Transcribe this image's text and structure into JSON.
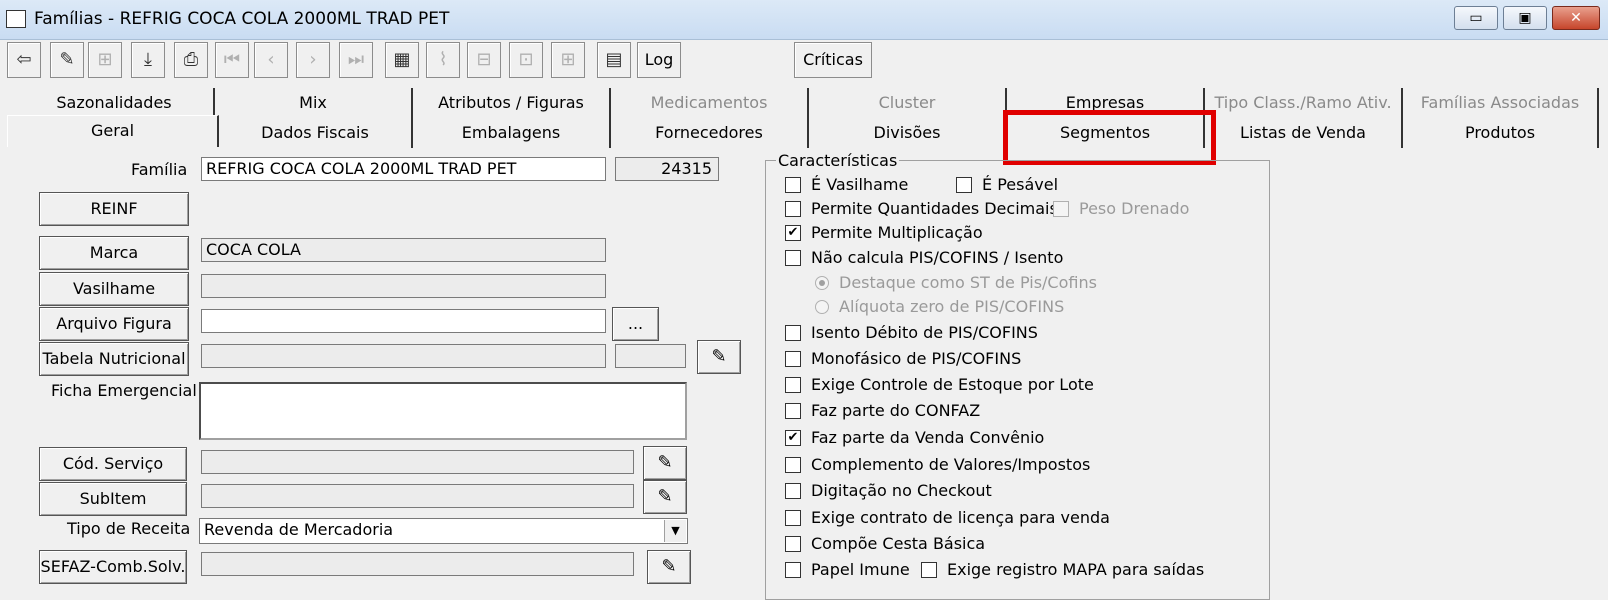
{
  "window": {
    "title": "Famílias - REFRIG COCA COLA 2000ML TRAD PET",
    "min": "▭",
    "max": "▣",
    "close": "✕"
  },
  "toolbar": {
    "log_label": "Log",
    "criticas_label": "Críticas",
    "icons": [
      "exit-icon",
      "eraser-icon",
      "tree-icon",
      "download-icon",
      "print-icon",
      "first-icon",
      "prev-icon",
      "next-icon",
      "last-icon",
      "grid-icon",
      "chart-icon",
      "layout1-icon",
      "layout2-icon",
      "layout3-icon",
      "calendar-icon"
    ]
  },
  "tabs_row1": [
    {
      "label": "Sazonalidades",
      "disabled": false
    },
    {
      "label": "Mix",
      "disabled": false
    },
    {
      "label": "Atributos / Figuras",
      "disabled": false
    },
    {
      "label": "Medicamentos",
      "disabled": true
    },
    {
      "label": "Cluster",
      "disabled": true
    },
    {
      "label": "Empresas",
      "disabled": false
    },
    {
      "label": "Tipo Class./Ramo Ativ.",
      "disabled": true
    },
    {
      "label": "Famílias Associadas",
      "disabled": true
    }
  ],
  "tabs_row2": [
    {
      "label": "Geral",
      "active": true
    },
    {
      "label": "Dados Fiscais"
    },
    {
      "label": "Embalagens"
    },
    {
      "label": "Fornecedores"
    },
    {
      "label": "Divisões"
    },
    {
      "label": "Segmentos",
      "highlighted": true
    },
    {
      "label": "Listas de Venda"
    },
    {
      "label": "Produtos"
    }
  ],
  "form": {
    "familia_label": "Família",
    "familia_value": "REFRIG COCA COLA 2000ML TRAD PET",
    "familia_code": "24315",
    "reinf_button": "REINF",
    "marca_button": "Marca",
    "marca_value": "COCA COLA",
    "vasilhame_button": "Vasilhame",
    "arquivo_button": "Arquivo Figura",
    "browse_button": "...",
    "tabela_button": "Tabela Nutricional",
    "ficha_label": "Ficha Emergencial",
    "cod_servico_button": "Cód. Serviço",
    "subitem_button": "SubItem",
    "tipo_receita_label": "Tipo de Receita",
    "tipo_receita_value": "Revenda de Mercadoria",
    "sefaz_button": "SEFAZ-Comb.Solv."
  },
  "caracteristicas": {
    "title": "Características",
    "items": [
      {
        "label": "É Vasilhame",
        "checked": false
      },
      {
        "label": "É Pesável",
        "checked": false
      },
      {
        "label": "Permite Quantidades Decimais",
        "checked": false
      },
      {
        "label": "Peso Drenado",
        "checked": false,
        "disabled": true
      },
      {
        "label": "Permite Multiplicação",
        "checked": true
      },
      {
        "label": "Não calcula PIS/COFINS / Isento",
        "checked": false
      },
      {
        "label": "Destaque como ST de Pis/Cofins",
        "radio": true,
        "selected": true,
        "disabled": true
      },
      {
        "label": "Alíquota zero de PIS/COFINS",
        "radio": true,
        "selected": false,
        "disabled": true
      },
      {
        "label": "Isento Débito de PIS/COFINS",
        "checked": false
      },
      {
        "label": "Monofásico de PIS/COFINS",
        "checked": false
      },
      {
        "label": "Exige Controle de Estoque por Lote",
        "checked": false
      },
      {
        "label": "Faz parte do CONFAZ",
        "checked": false
      },
      {
        "label": "Faz parte da Venda Convênio",
        "checked": true
      },
      {
        "label": "Complemento de Valores/Impostos",
        "checked": false
      },
      {
        "label": "Digitação no Checkout",
        "checked": false
      },
      {
        "label": "Exige contrato de licença para venda",
        "checked": false
      },
      {
        "label": "Compõe Cesta Básica",
        "checked": false
      },
      {
        "label": "Papel Imune",
        "checked": false
      },
      {
        "label": "Exige registro MAPA para saídas",
        "checked": false
      }
    ]
  }
}
